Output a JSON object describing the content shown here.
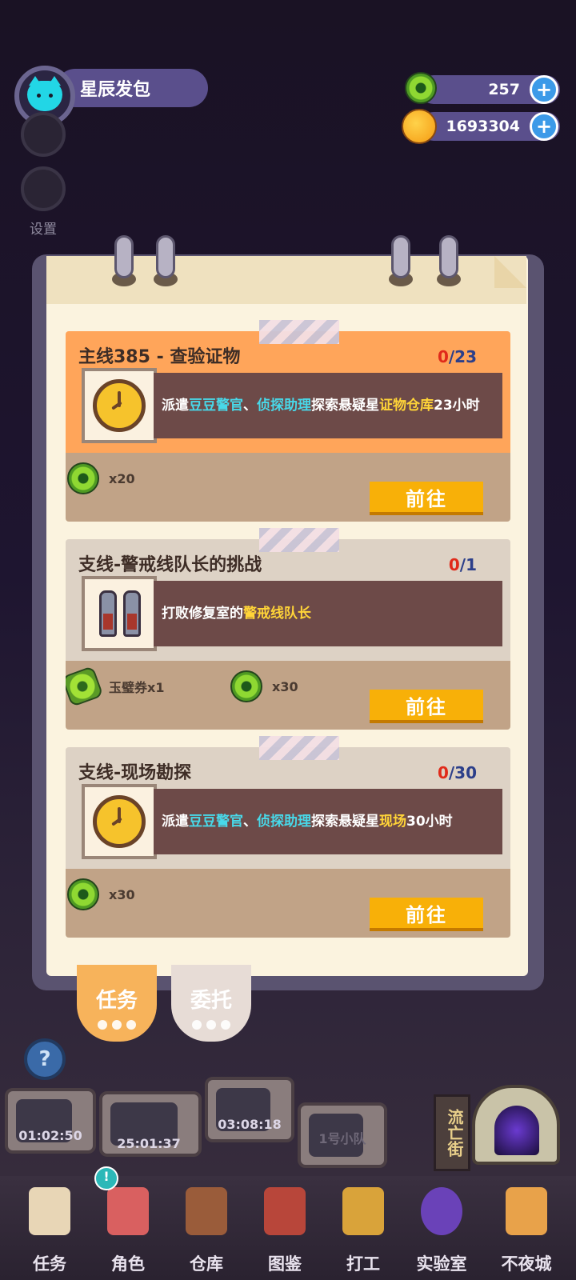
{
  "profile": {
    "name": "星辰发包"
  },
  "side": {
    "settings_label": "设置"
  },
  "resources": [
    {
      "icon": "jade-coin-icon",
      "value": "257"
    },
    {
      "icon": "planet-coin-icon",
      "value": "1693304"
    }
  ],
  "quests": [
    {
      "title": "主线385 - 查验证物",
      "progress_now": "0",
      "progress_total": "/23",
      "icon": "stopwatch-icon",
      "desc_parts": [
        "派遣",
        "豆豆警官",
        "、",
        "侦探助理",
        "探索悬疑星",
        "证物仓库",
        "23小时"
      ],
      "rewards": [
        {
          "icon": "jade-coin-icon",
          "label": "x20"
        }
      ],
      "button": "前往"
    },
    {
      "title": "支线-警戒线队长的挑战",
      "progress_now": "0",
      "progress_total": "/1",
      "icon": "guards-icon",
      "desc_parts": [
        "打败修复室的",
        "警戒线队长"
      ],
      "rewards": [
        {
          "icon": "jade-ticket-icon",
          "label": "玉璧券x1"
        },
        {
          "icon": "jade-coin-icon",
          "label": "x30"
        }
      ],
      "button": "前往"
    },
    {
      "title": "支线-现场勘探",
      "progress_now": "0",
      "progress_total": "/30",
      "icon": "stopwatch-icon",
      "desc_parts": [
        "派遣",
        "豆豆警官",
        "、",
        "侦探助理",
        "探索悬疑星",
        "现场",
        "30小时"
      ],
      "rewards": [
        {
          "icon": "jade-coin-icon",
          "label": "x30"
        }
      ],
      "button": "前往"
    }
  ],
  "tabs": {
    "tasks": "任务",
    "commission": "委托"
  },
  "scene": {
    "timers": [
      "01:02:50",
      "25:01:37",
      "03:08:18"
    ],
    "team_label": "1号小队",
    "sign": "流亡街",
    "help": "?"
  },
  "badge": "!",
  "nav": [
    "任务",
    "角色",
    "仓库",
    "图鉴",
    "打工",
    "实验室",
    "不夜城"
  ],
  "colors": {
    "accent_orange": "#ffa55a",
    "button_yellow": "#f8b008",
    "highlight_cyan": "#48d8e8",
    "highlight_yellow": "#ffd438"
  }
}
